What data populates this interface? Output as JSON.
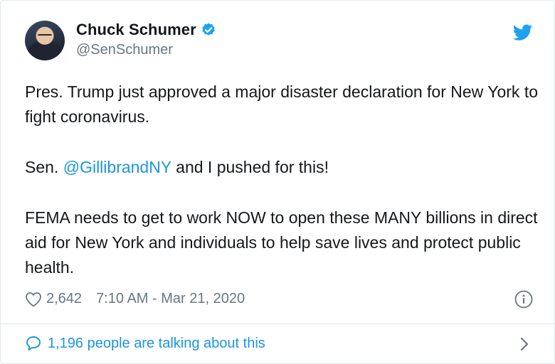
{
  "tweet": {
    "author": {
      "display_name": "Chuck Schumer",
      "handle": "@SenSchumer",
      "verified": true
    },
    "body": {
      "p1": "Pres. Trump just approved a major disaster declaration for New York to fight coronavirus.",
      "p2_prefix": "Sen. ",
      "p2_mention": "@GillibrandNY",
      "p2_suffix": " and I pushed for this!",
      "p3": "FEMA needs to get to work NOW to open these MANY billions in direct aid for New York and individuals to help save lives and protect public health."
    },
    "likes": "2,642",
    "timestamp": "7:10 AM - Mar 21, 2020",
    "conversation_link": "1,196 people are talking about this"
  },
  "colors": {
    "twitter_blue": "#1da1f2",
    "link_blue": "#1b95e0",
    "secondary_text": "#657786",
    "primary_text": "#14171a",
    "divider": "#e1e8ed"
  },
  "icons": {
    "verified": "verified-badge-icon",
    "brand": "twitter-bird-icon",
    "like": "heart-icon",
    "info": "info-icon",
    "reply": "speech-bubble-icon",
    "more": "chevron-right-icon"
  }
}
